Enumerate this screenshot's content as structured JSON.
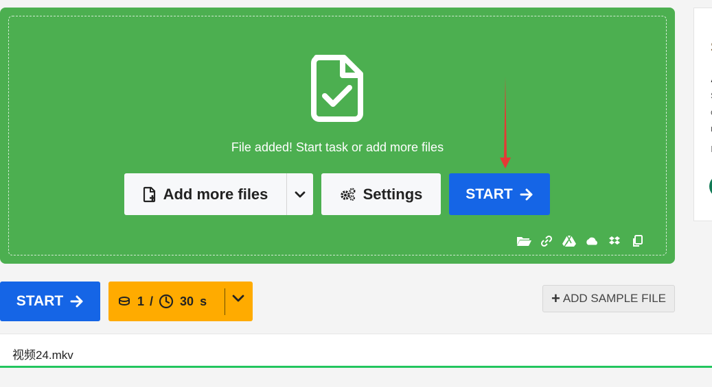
{
  "dropzone": {
    "status_text": "File added! Start task or add more files",
    "add_files_label": "Add more files",
    "settings_label": "Settings",
    "start_label": "START",
    "source_icons": [
      "folder-icon",
      "link-icon",
      "google-drive-icon",
      "onedrive-icon",
      "dropbox-icon",
      "clipboard-icon"
    ]
  },
  "toolbar": {
    "start_label": "START",
    "credits_value": "1",
    "credits_separator": "/",
    "time_value": "30",
    "time_unit": "s",
    "add_sample_label": "ADD SAMPLE FILE"
  },
  "file_list": {
    "files": [
      {
        "name": "视频24.mkv"
      }
    ]
  },
  "side_card": {
    "fragments": [
      "S",
      "A",
      "S",
      "c",
      "r",
      "E"
    ]
  },
  "colors": {
    "dropzone_green": "#4caf50",
    "primary_blue": "#1565e6",
    "credits_amber": "#ffab00",
    "progress_green": "#22c55e",
    "annotation_red": "#e53935"
  }
}
